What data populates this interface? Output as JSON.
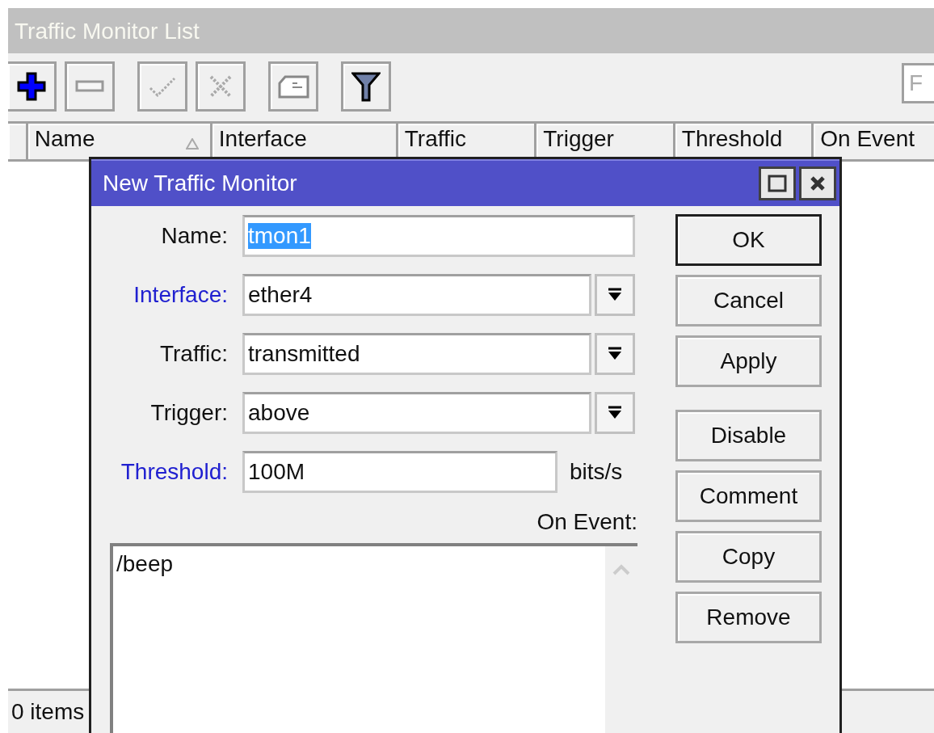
{
  "list_window": {
    "title": "Traffic Monitor List",
    "toolbar": [
      {
        "kind": "add",
        "disabled": false
      },
      {
        "kind": "remove",
        "disabled": true
      },
      {
        "kind": "enable",
        "disabled": true
      },
      {
        "kind": "disable",
        "disabled": true
      },
      {
        "kind": "comment",
        "disabled": true
      },
      {
        "kind": "filter",
        "disabled": false
      }
    ],
    "search": {
      "placeholder": "F"
    },
    "columns": [
      {
        "label": "Name",
        "sorted": true
      },
      {
        "label": "Interface",
        "sorted": false
      },
      {
        "label": "Traffic",
        "sorted": false
      },
      {
        "label": "Trigger",
        "sorted": false
      },
      {
        "label": "Threshold",
        "sorted": false
      },
      {
        "label": "On Event",
        "sorted": false
      }
    ],
    "status": "0 items"
  },
  "dialog": {
    "title": "New Traffic Monitor",
    "fields": [
      {
        "kind": "text",
        "label": "Name:",
        "value": "tmon1",
        "changed": false,
        "text_selected": true
      },
      {
        "kind": "dropdown",
        "label": "Interface:",
        "value": "ether4",
        "changed": true,
        "text_selected": false
      },
      {
        "kind": "dropdown",
        "label": "Traffic:",
        "value": "transmitted",
        "changed": false,
        "text_selected": false
      },
      {
        "kind": "dropdown",
        "label": "Trigger:",
        "value": "above",
        "changed": false,
        "text_selected": false
      },
      {
        "kind": "unit",
        "label": "Threshold:",
        "value": "100M",
        "unit": "bits/s",
        "changed": true,
        "text_selected": false
      }
    ],
    "on_event": {
      "label": "On Event:",
      "value": "/beep"
    },
    "buttons": [
      {
        "label": "OK",
        "default": true
      },
      {
        "label": "Cancel",
        "default": false
      },
      {
        "label": "Apply",
        "default": false
      }
    ],
    "extra_buttons": [
      {
        "label": "Disable"
      },
      {
        "label": "Comment"
      },
      {
        "label": "Copy"
      },
      {
        "label": "Remove"
      }
    ]
  }
}
